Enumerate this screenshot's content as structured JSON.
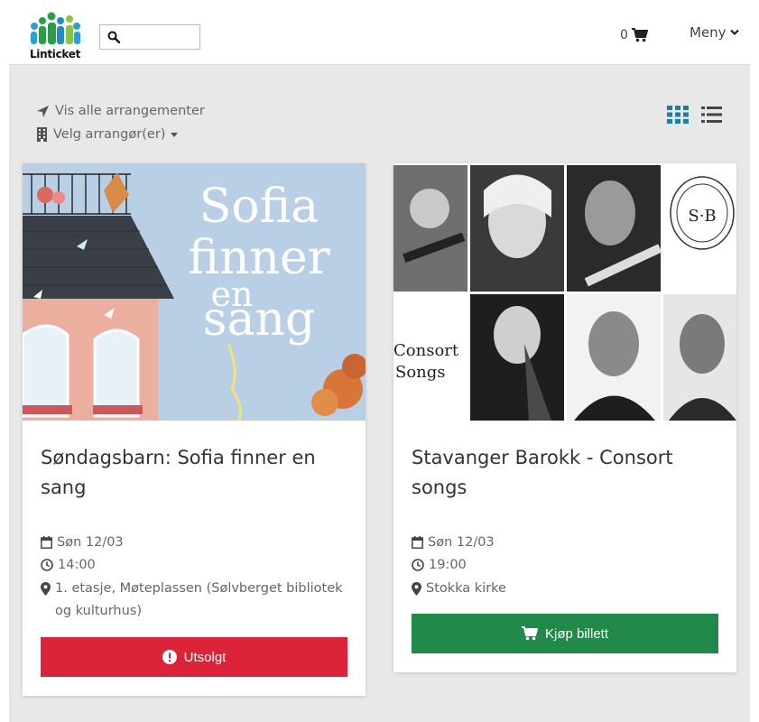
{
  "header": {
    "logo_text": "Linticket",
    "search": {
      "value": "",
      "placeholder": ""
    },
    "cart_count": "0",
    "menu_label": "Meny"
  },
  "filters": {
    "show_all": "Vis alle arrangementer",
    "select_organizer": "Velg arrangør(er)"
  },
  "events": [
    {
      "title": "Søndagsbarn: Sofia finner en sang",
      "image_text": [
        "Sofia",
        "finner",
        "en",
        "sang"
      ],
      "date": "Søn 12/03",
      "time": "14:00",
      "location": "1. etasje, Møteplassen (Sølvberget bibliotek og kulturhus)",
      "button": "Utsolgt",
      "button_color": "#dc2438"
    },
    {
      "title": "Stavanger Barokk - Consort songs",
      "image_text": [
        "Consort",
        "Songs",
        "S·B"
      ],
      "date": "Søn 12/03",
      "time": "19:00",
      "location": "Stokka kirke",
      "button": "Kjøp billett",
      "button_color": "#218a4b"
    }
  ],
  "colors": {
    "accent": "#1a7fa3",
    "danger": "#dc2438",
    "success": "#218a4b"
  }
}
